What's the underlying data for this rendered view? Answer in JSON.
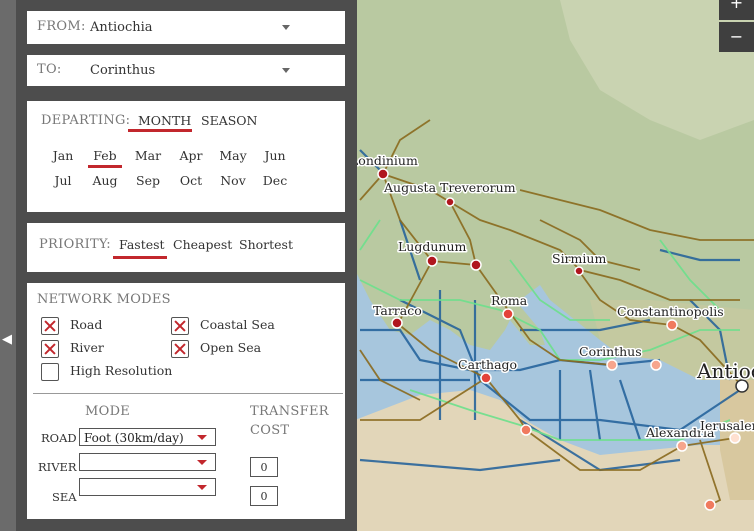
{
  "from": {
    "label": "FROM:",
    "value": "Antiochia"
  },
  "to": {
    "label": "TO:",
    "value": "Corinthus"
  },
  "departing": {
    "label": "DEPARTING:",
    "tabs": [
      "MONTH",
      "SEASON"
    ],
    "selected_tab": "MONTH",
    "months": [
      "Jan",
      "Feb",
      "Mar",
      "Apr",
      "May",
      "Jun",
      "Jul",
      "Aug",
      "Sep",
      "Oct",
      "Nov",
      "Dec"
    ],
    "selected_month": "Feb"
  },
  "priority": {
    "label": "PRIORITY:",
    "options": [
      "Fastest",
      "Cheapest",
      "Shortest"
    ],
    "selected": "Fastest"
  },
  "network": {
    "title": "NETWORK MODES",
    "road": "Road",
    "coastal": "Coastal Sea",
    "river": "River",
    "open": "Open Sea",
    "hires": "High Resolution",
    "checked": {
      "road": true,
      "coastal": true,
      "river": true,
      "open": true,
      "hires": false
    }
  },
  "transfer": {
    "mode_header": "MODE",
    "cost_header_1": "TRANSFER",
    "cost_header_2": "COST",
    "road_label": "ROAD",
    "river_label": "RIVER",
    "sea_label": "SEA",
    "road_mode": "Foot (30km/day)",
    "river_mode": "",
    "sea_mode": "",
    "river_cost": "0",
    "sea_cost": "0"
  },
  "map": {
    "zoom_in": "+",
    "zoom_out": "−",
    "collapse": "◀",
    "cities": [
      "Londinium",
      "Augusta Treverorum",
      "Lugdunum",
      "Sirmium",
      "Tarraco",
      "Roma",
      "Constantinopolis",
      "Corinthus",
      "Carthago",
      "Antiochia",
      "Alexandria",
      "Ierusalem"
    ]
  },
  "colors": {
    "accent": "#c2272d",
    "road": "#8a6a1e",
    "sea_route": "#1f5f9a",
    "coastal_route": "#6de08c",
    "sea": "#9dc3dc",
    "land": "#b7c9a4"
  }
}
